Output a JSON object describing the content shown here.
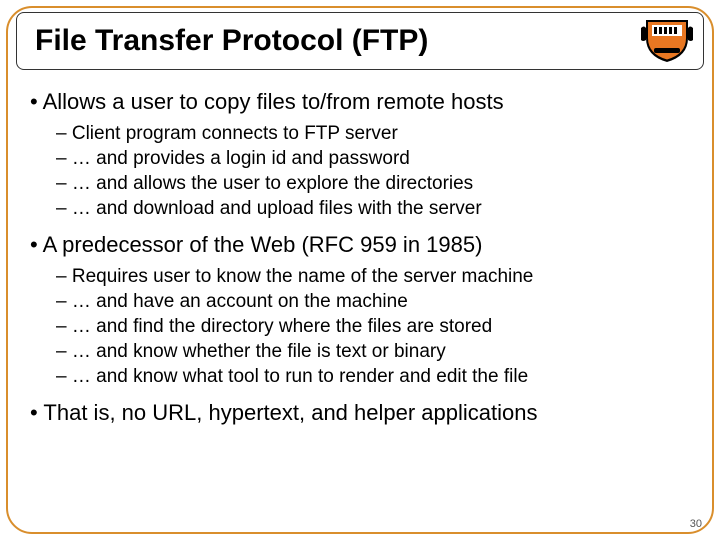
{
  "title": "File Transfer Protocol (FTP)",
  "page_number": "30",
  "sections": [
    {
      "main": "Allows a user to copy files to/from remote hosts",
      "subs": [
        "Client program connects to FTP server",
        "… and provides a login id and password",
        "… and allows the user to explore the directories",
        "… and download and upload files with the server"
      ]
    },
    {
      "main": "A predecessor of the Web (RFC 959 in 1985)",
      "subs": [
        "Requires user to know the name of the server machine",
        "… and have an account on the machine",
        "… and find the directory where the files are stored",
        "… and know whether the file is text or binary",
        "… and know what tool to run to render and edit the file"
      ]
    },
    {
      "main": "That is, no URL, hypertext, and helper applications",
      "subs": []
    }
  ]
}
